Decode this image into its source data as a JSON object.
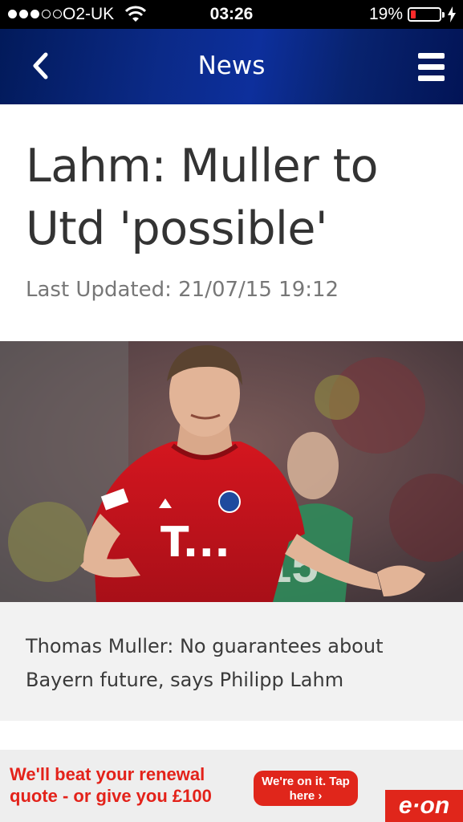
{
  "status_bar": {
    "signal_bars_filled": 3,
    "signal_bars_total": 5,
    "carrier": "O2-UK",
    "time": "03:26",
    "battery_percent": "19%",
    "battery_level": 0.19
  },
  "nav": {
    "title": "News",
    "back_icon": "chevron-left-icon",
    "menu_icon": "hamburger-menu-icon",
    "bar_color": "#0b2a88"
  },
  "article": {
    "headline": "Lahm: Muller to Utd 'possible'",
    "last_updated": "Last Updated: 21/07/15 19:12",
    "photo_shirt_text": "T...",
    "caption": "Thomas Muller: No guarantees about Bayern future, says Philipp Lahm"
  },
  "ad": {
    "headline": "We'll beat your renewal quote - or give you £100",
    "button_label": "We're on it. Tap here ›",
    "brand": "e·on",
    "brand_color": "#e0261b"
  }
}
